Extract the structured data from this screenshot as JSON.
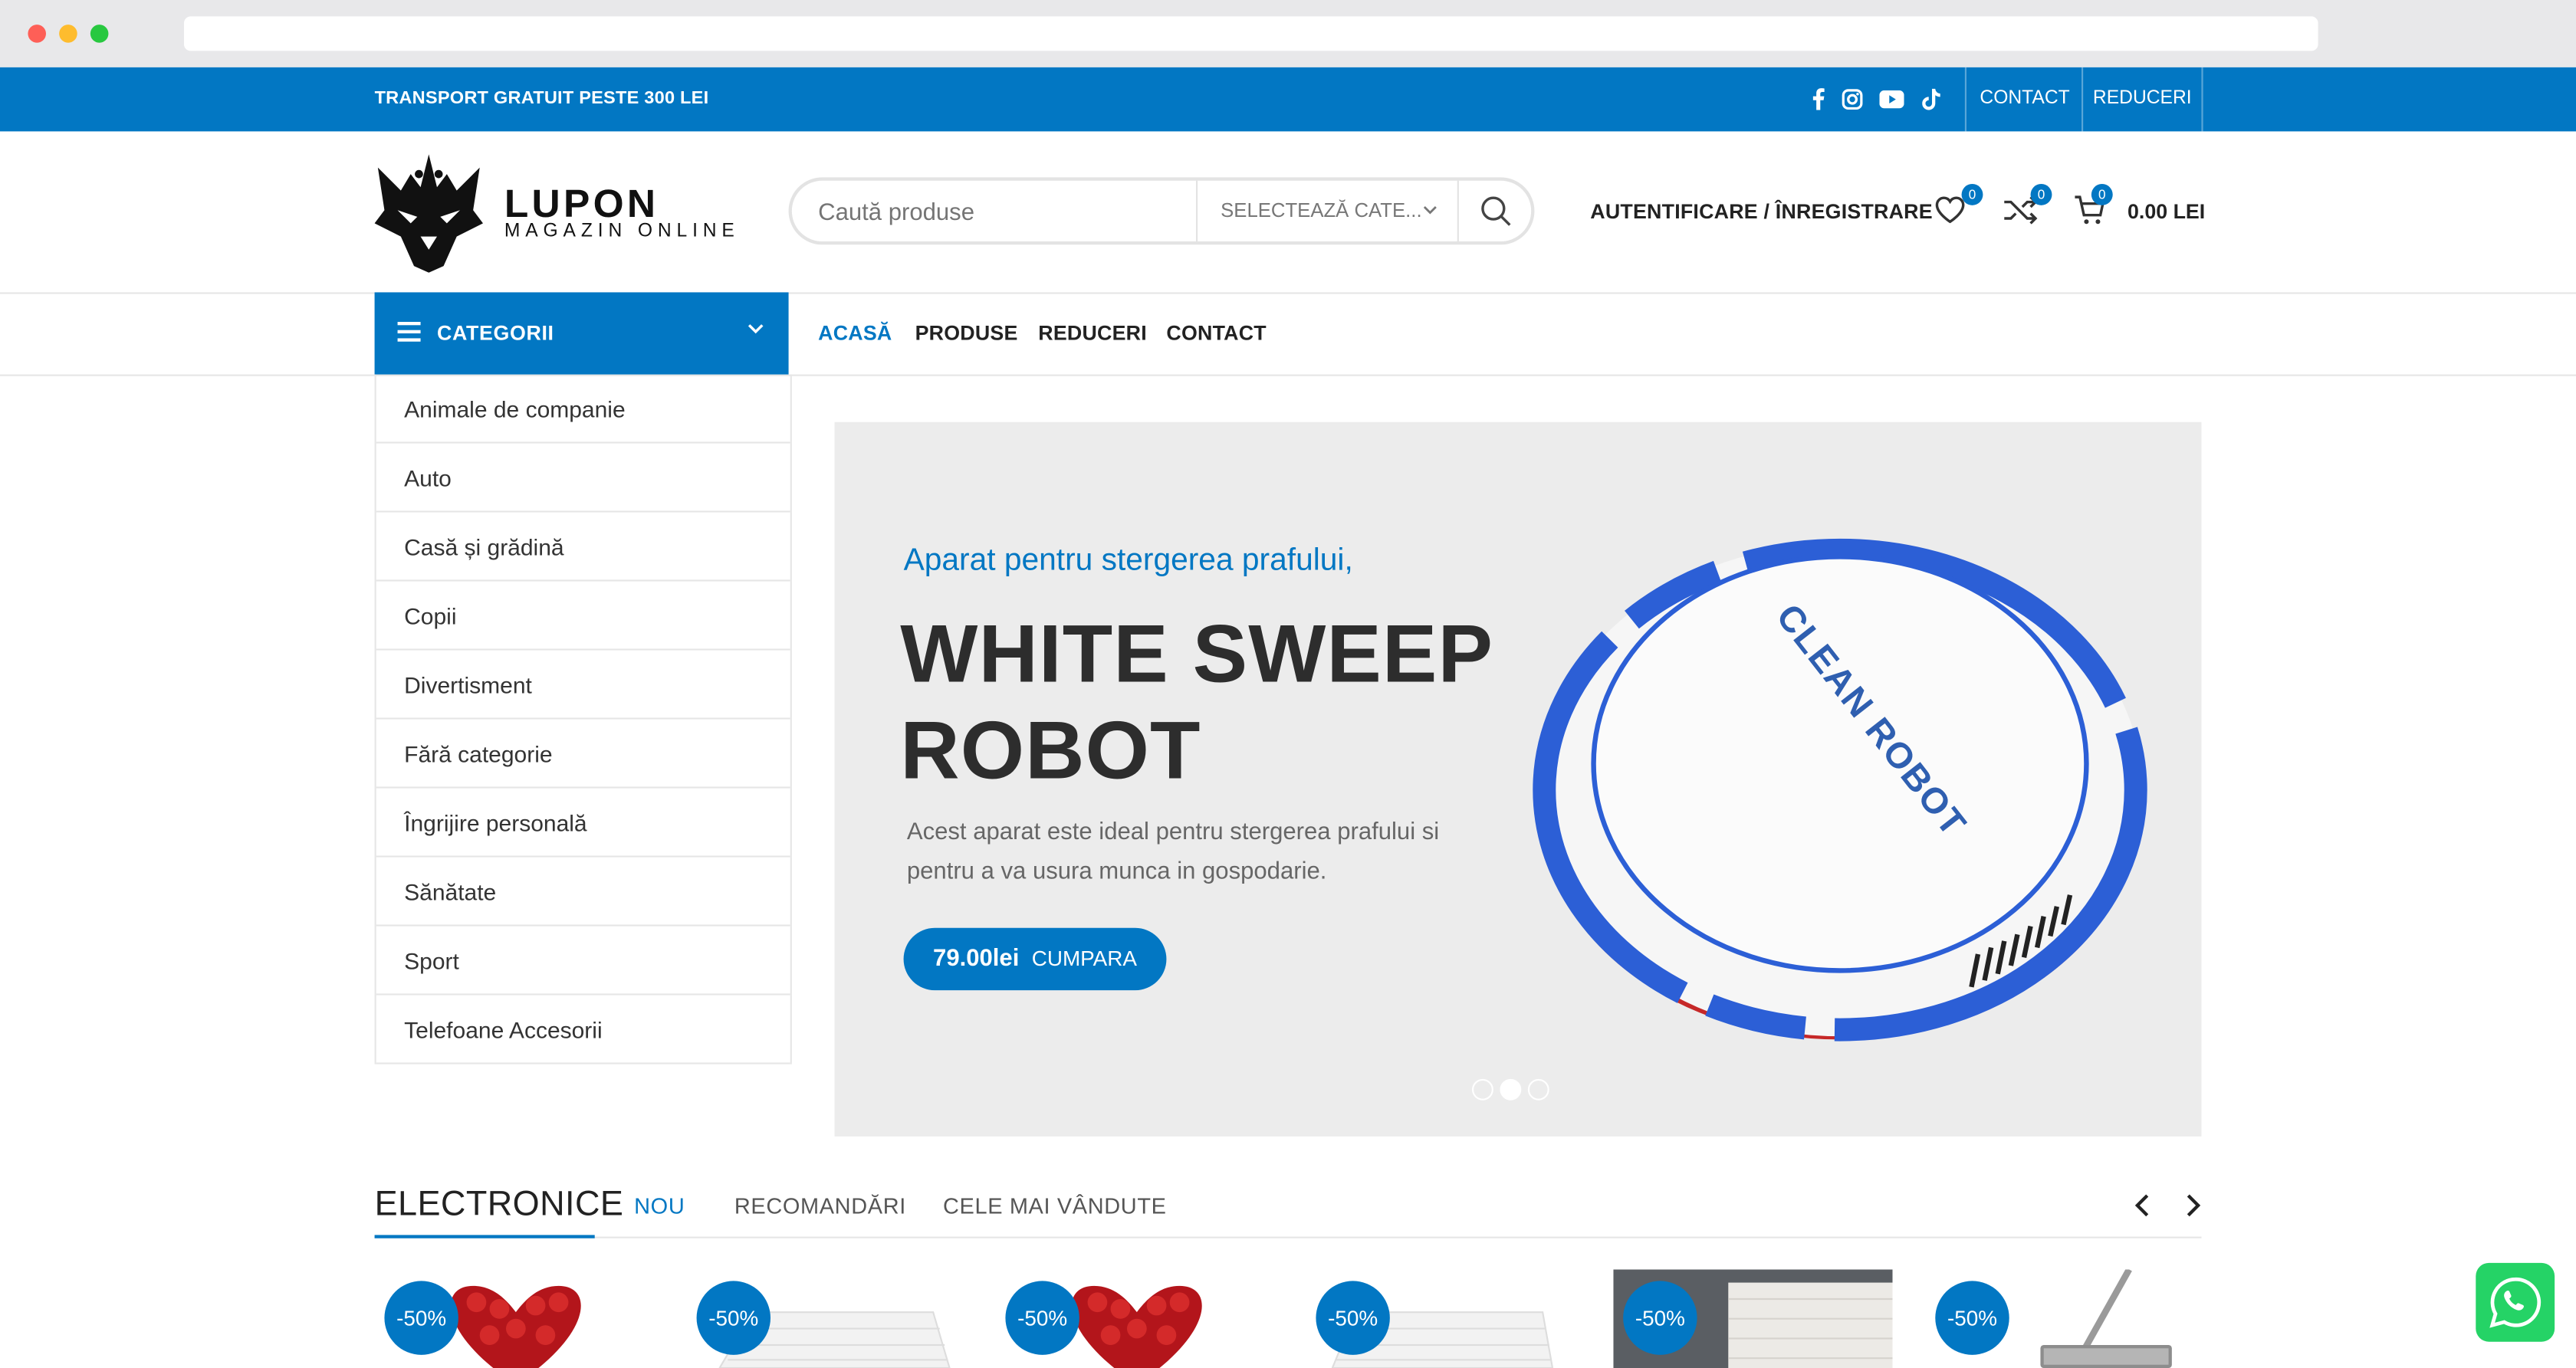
{
  "topbar": {
    "shipping": "TRANSPORT GRATUIT PESTE 300 LEI",
    "social": [
      "facebook-icon",
      "instagram-icon",
      "youtube-icon",
      "tiktok-icon"
    ],
    "links": [
      "CONTACT",
      "REDUCERI"
    ]
  },
  "header": {
    "logo_name": "LUPON",
    "logo_sub": "MAGAZIN ONLINE",
    "search_placeholder": "Caută produse",
    "category_select": "SELECTEAZĂ CATE...",
    "auth": "AUTENTIFICARE / ÎNREGISTRARE",
    "wishlist_count": "0",
    "compare_count": "0",
    "cart_count": "0",
    "cart_total": "0.00 LEI"
  },
  "nav": {
    "categories_label": "CATEGORII",
    "menu": [
      "ACASĂ",
      "PRODUSE",
      "REDUCERI",
      "CONTACT"
    ]
  },
  "categories": [
    "Animale de companie",
    "Auto",
    "Casă și grădină",
    "Copii",
    "Divertisment",
    "Fără categorie",
    "Îngrijire personală",
    "Sănătate",
    "Sport",
    "Telefoane Accesorii"
  ],
  "hero": {
    "subtitle": "Aparat pentru stergerea prafului,",
    "title_line1": "WHITE SWEEP",
    "title_line2": "ROBOT",
    "description": "Acest aparat este ideal pentru stergerea prafului si pentru a va usura munca in gospodarie.",
    "price": "79.00lei",
    "cta": "CUMPARA",
    "product_print": "CLEAN ROBOT",
    "slides": 3,
    "active_slide": 2
  },
  "section": {
    "title": "ELECTRONICE",
    "tabs": [
      "NOU",
      "RECOMANDĂRI",
      "CELE MAI VÂNDUTE"
    ]
  },
  "products": [
    {
      "discount": "-50%",
      "image": "red-roses-heart"
    },
    {
      "discount": "-50%",
      "image": "white-3d-wall-panel"
    },
    {
      "discount": "-50%",
      "image": "red-roses-heart"
    },
    {
      "discount": "-50%",
      "image": "white-3d-wall-panel"
    },
    {
      "discount": "-50%",
      "image": "brick-wall-room"
    },
    {
      "discount": "-50%",
      "image": "flat-mop"
    }
  ],
  "colors": {
    "accent": "#0277c3",
    "whatsapp": "#25d366"
  }
}
